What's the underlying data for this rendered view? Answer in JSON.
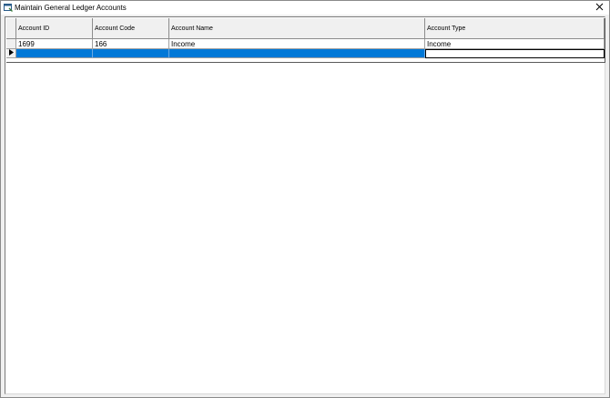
{
  "window": {
    "title": "Maintain General Ledger Accounts",
    "icon": "app-form-icon",
    "close_icon": "close-icon"
  },
  "grid": {
    "columns": [
      "Account ID",
      "Account Code",
      "Account Name",
      "Account Type"
    ],
    "rows": [
      [
        "1699",
        "166",
        "Income",
        "Income"
      ]
    ],
    "new_row_indicator": "row-pointer-icon",
    "selection_color": "#0078d7"
  }
}
